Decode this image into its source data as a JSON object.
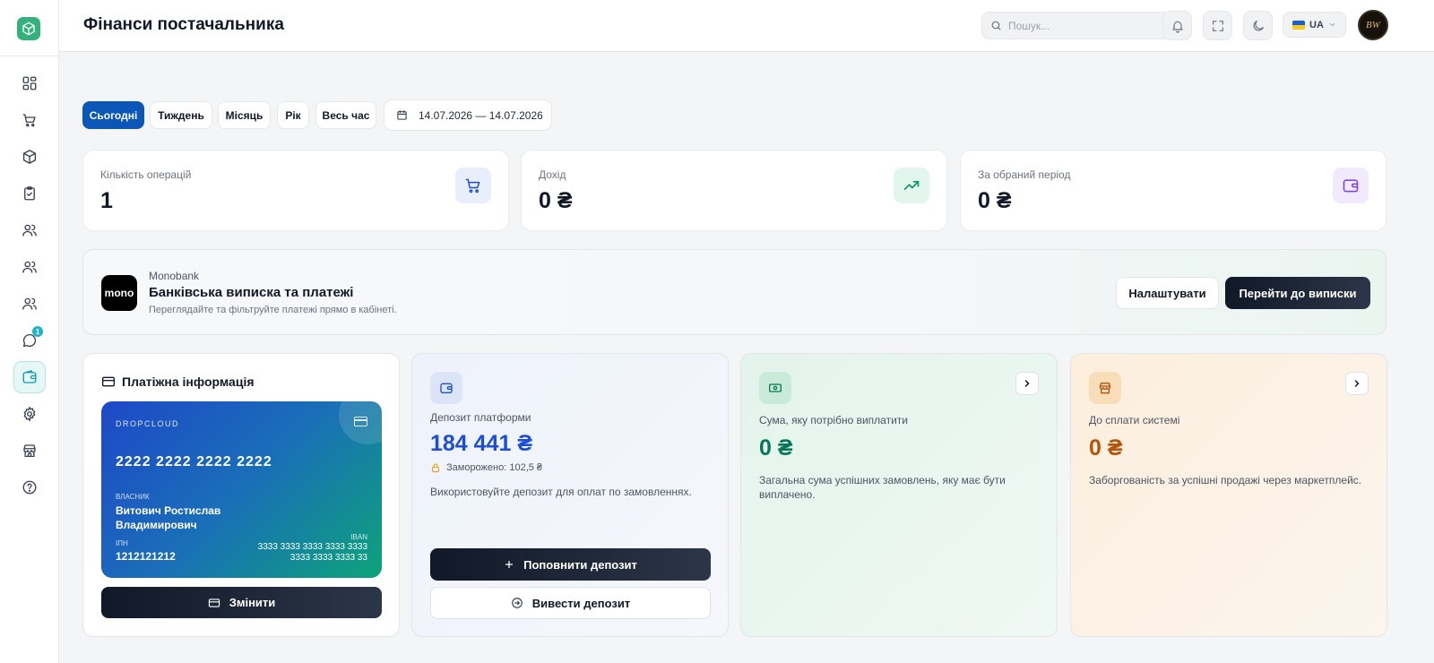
{
  "header": {
    "title": "Фінанси постачальника",
    "search_placeholder": "Пошук...",
    "lang": "UA",
    "avatar_text": "BW"
  },
  "sidebar": {
    "items": [
      {
        "icon": "dashboard-icon"
      },
      {
        "icon": "cart-icon"
      },
      {
        "icon": "box-icon"
      },
      {
        "icon": "clipboard-check-icon"
      },
      {
        "icon": "users-icon"
      },
      {
        "icon": "users-icon"
      },
      {
        "icon": "users-icon"
      },
      {
        "icon": "chat-icon",
        "badge": "1"
      },
      {
        "icon": "wallet-icon",
        "active": true
      },
      {
        "icon": "gear-icon"
      },
      {
        "icon": "store-icon"
      },
      {
        "icon": "help-icon"
      }
    ]
  },
  "filters": {
    "periods": [
      "Сьогодні",
      "Тиждень",
      "Місяць",
      "Рік",
      "Весь час"
    ],
    "active": "Сьогодні",
    "date_range": "14.07.2026 — 14.07.2026"
  },
  "stats": [
    {
      "label": "Кількість операцій",
      "value": "1",
      "icon": "cart-icon"
    },
    {
      "label": "Дохід",
      "value": "0 ₴",
      "icon": "trending-up-icon"
    },
    {
      "label": "За обраний період",
      "value": "0 ₴",
      "icon": "wallet-icon"
    }
  ],
  "monobank": {
    "logo": "mono",
    "bank": "Monobank",
    "title": "Банківська виписка та платежі",
    "description": "Переглядайте та фільтруйте платежі прямо в кабінеті.",
    "settings_button": "Налаштувати",
    "statement_button": "Перейти до виписки"
  },
  "payment": {
    "title": "Платіжна інформація",
    "card": {
      "brand": "DROPCLOUD",
      "number": "2222 2222 2222 2222",
      "owner_label": "ВЛАСНИК",
      "owner": "Витович Ростислав Владимирович",
      "ipn_label": "ІПН",
      "ipn": "1212121212",
      "iban_label": "IBAN",
      "iban": "3333 3333 3333 3333 3333 3333 3333 3333 33"
    },
    "change_button": "Змінити"
  },
  "deposit": {
    "label": "Депозит платформи",
    "value": "184 441 ₴",
    "frozen": "Заморожено: 102,5 ₴",
    "description": "Використовуйте депозит для оплат по замовленнях.",
    "topup_button": "Поповнити депозит",
    "withdraw_button": "Вивести депозит"
  },
  "payout": {
    "label": "Сума, яку потрібно виплатити",
    "value": "0 ₴",
    "description": "Загальна сума успішних замовлень, яку має бути виплачено."
  },
  "system_due": {
    "label": "До сплати системі",
    "value": "0 ₴",
    "description": "Заборгованість за успішні продажі через маркетплейс."
  },
  "colors": {
    "primary": "#0b57b8",
    "dark_button": "#111827",
    "deposit_value": "#1d4ed8",
    "payout_value": "#047857",
    "system_value": "#b45309",
    "accent_teal": "#0e9aa7"
  }
}
